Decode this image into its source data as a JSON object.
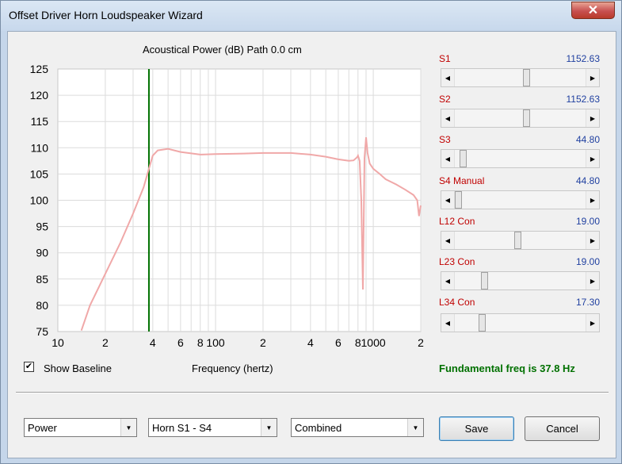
{
  "window": {
    "title": "Offset Driver Horn Loudspeaker Wizard",
    "close_label": "✕"
  },
  "chart": {
    "title": "Acoustical Power (dB)   Path 0.0 cm",
    "xlabel": "Frequency (hertz)"
  },
  "chart_data": {
    "type": "line",
    "title": "Acoustical Power (dB)   Path 0.0 cm",
    "xlabel": "Frequency (hertz)",
    "ylabel": "",
    "xscale": "log",
    "xlim": [
      10,
      2000
    ],
    "ylim": [
      75,
      125
    ],
    "yticks": [
      "125",
      "120",
      "115",
      "110",
      "105",
      "100",
      "95",
      "90",
      "85",
      "80",
      "75"
    ],
    "xticks": [
      {
        "value": 10,
        "label": "10"
      },
      {
        "value": 20,
        "label": "2"
      },
      {
        "value": 40,
        "label": "4"
      },
      {
        "value": 60,
        "label": "6"
      },
      {
        "value": 80,
        "label": "8"
      },
      {
        "value": 100,
        "label": "100"
      },
      {
        "value": 200,
        "label": "2"
      },
      {
        "value": 400,
        "label": "4"
      },
      {
        "value": 600,
        "label": "6"
      },
      {
        "value": 800,
        "label": "8"
      },
      {
        "value": 1000,
        "label": "1000"
      },
      {
        "value": 2000,
        "label": "2"
      }
    ],
    "grid": true,
    "marker_line": {
      "x": 37.8,
      "color": "#007000"
    },
    "series": [
      {
        "color": "#f0a8a8",
        "x": [
          14.1,
          16,
          20,
          25,
          30,
          35,
          37.8,
          40,
          43,
          50,
          60,
          80,
          100,
          150,
          200,
          300,
          400,
          500,
          600,
          700,
          750,
          790,
          800,
          820,
          840,
          860,
          880,
          900,
          920,
          950,
          1000,
          1100,
          1200,
          1400,
          1600,
          1800,
          1900,
          1950,
          2000
        ],
        "y": [
          75.2,
          80,
          86,
          92,
          97.5,
          102.5,
          106,
          108.5,
          109.5,
          109.8,
          109.2,
          108.7,
          108.8,
          108.9,
          109,
          109,
          108.7,
          108.3,
          107.8,
          107.5,
          107.6,
          108.2,
          108.5,
          107.5,
          100,
          83,
          108,
          112,
          109,
          107,
          106,
          105,
          104,
          103,
          102,
          101,
          100,
          97,
          99
        ]
      }
    ]
  },
  "baseline": {
    "label": "Show Baseline",
    "checked_glyph": "✔"
  },
  "fundamental": {
    "text": "Fundamental freq is 37.8 Hz",
    "color": "#007000"
  },
  "sliders": [
    {
      "label": "S1",
      "value": "1152.63",
      "position": 0.55
    },
    {
      "label": "S2",
      "value": "1152.63",
      "position": 0.55
    },
    {
      "label": "S3",
      "value": "44.80",
      "position": 0.04
    },
    {
      "label": "S4 Manual",
      "value": "44.80",
      "position": 0.0
    },
    {
      "label": "L12 Con",
      "value": "19.00",
      "position": 0.48
    },
    {
      "label": "L23 Con",
      "value": "19.00",
      "position": 0.21
    },
    {
      "label": "L34 Con",
      "value": "17.30",
      "position": 0.19
    }
  ],
  "combos": [
    {
      "value": "Power"
    },
    {
      "value": "Horn S1 - S4"
    },
    {
      "value": "Combined"
    }
  ],
  "buttons": {
    "save": "Save",
    "cancel": "Cancel"
  },
  "colors": {
    "slider_label": "#c00000",
    "slider_value": "#2040a0"
  }
}
